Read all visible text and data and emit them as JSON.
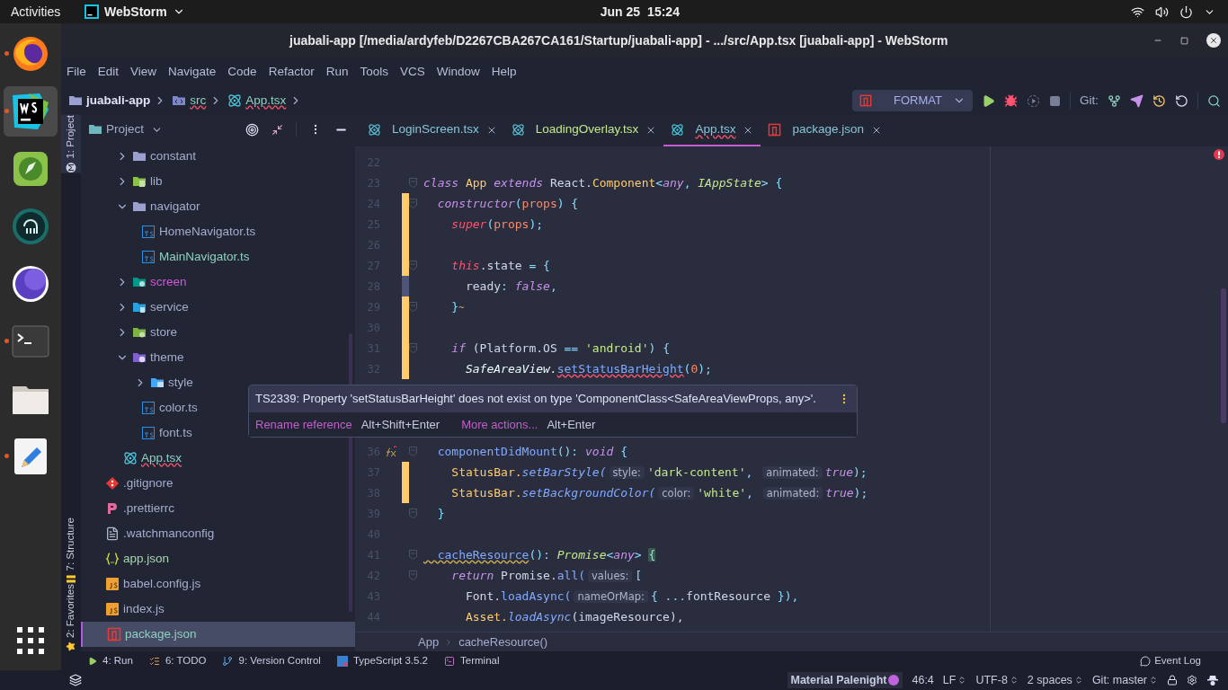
{
  "top_bar": {
    "activities": "Activities",
    "app_menu": "WebStorm",
    "date": "Jun 25",
    "time": "15:24"
  },
  "dock": [
    {
      "kind": "firefox",
      "running": true,
      "selected": false
    },
    {
      "kind": "webstorm",
      "running": true,
      "selected": true
    },
    {
      "kind": "rocket",
      "running": false,
      "selected": false
    },
    {
      "kind": "octopus",
      "running": false,
      "selected": false
    },
    {
      "kind": "moon",
      "running": false,
      "selected": false
    },
    {
      "kind": "terminal",
      "running": true,
      "selected": false
    },
    {
      "kind": "files",
      "running": false,
      "selected": false
    },
    {
      "kind": "editor",
      "running": true,
      "selected": false
    }
  ],
  "window": {
    "title": "juabali-app [/media/ardyfeb/D2267CBA267CA161/Startup/juabali-app] - .../src/App.tsx [juabali-app] - WebStorm"
  },
  "menu": [
    "File",
    "Edit",
    "View",
    "Navigate",
    "Code",
    "Refactor",
    "Run",
    "Tools",
    "VCS",
    "Window",
    "Help"
  ],
  "nav_path": [
    {
      "label": "juabali-app",
      "kind": "project",
      "error": false
    },
    {
      "label": "src",
      "kind": "source",
      "error": true
    },
    {
      "label": "App.tsx",
      "kind": "react",
      "error": true
    }
  ],
  "toolbar": {
    "run_config": "FORMAT",
    "git_label": "Git:"
  },
  "tool_strip": {
    "top": [
      {
        "label": "1: Project",
        "selected": true
      }
    ],
    "bottom": [
      {
        "label": "7: Structure",
        "selected": false
      },
      {
        "label": "2: Favorites",
        "selected": false
      }
    ]
  },
  "project": {
    "title": "Project",
    "src_children": [
      {
        "label": "constant",
        "kind": "folder",
        "expanded": false,
        "color": "#a6accd",
        "selected": false
      },
      {
        "label": "lib",
        "kind": "lib",
        "expanded": false,
        "color": "#a6accd",
        "selected": false
      },
      {
        "label": "navigator",
        "kind": "folder",
        "expanded": true,
        "color": "#a6accd",
        "selected": false,
        "children": [
          {
            "label": "HomeNavigator.ts",
            "kind": "ts",
            "color": "#a6accd",
            "selected": false
          },
          {
            "label": "MainNavigator.ts",
            "kind": "ts",
            "color": "#8ed1c0",
            "selected": false
          }
        ]
      },
      {
        "label": "screen",
        "kind": "screen",
        "expanded": false,
        "color": "#d05ad6",
        "selected": false
      },
      {
        "label": "service",
        "kind": "service",
        "expanded": false,
        "color": "#a6accd",
        "selected": false
      },
      {
        "label": "store",
        "kind": "store",
        "expanded": false,
        "color": "#a6accd",
        "selected": false
      },
      {
        "label": "theme",
        "kind": "theme",
        "expanded": true,
        "color": "#a6accd",
        "selected": false,
        "children": [
          {
            "label": "style",
            "kind": "style",
            "expanded": false,
            "color": "#a6accd",
            "selected": false
          },
          {
            "label": "color.ts",
            "kind": "ts",
            "color": "#a6accd",
            "selected": false
          },
          {
            "label": "font.ts",
            "kind": "ts",
            "color": "#a6accd",
            "selected": false
          }
        ]
      },
      {
        "label": "App.tsx",
        "kind": "react",
        "color": "#8ed1c0",
        "selected": false,
        "error": true
      }
    ],
    "root_items": [
      {
        "label": ".gitignore",
        "kind": "git",
        "color": "#a6accd",
        "selected": false
      },
      {
        "label": ".prettierrc",
        "kind": "prettier",
        "color": "#a6accd",
        "selected": false
      },
      {
        "label": ".watchmanconfig",
        "kind": "file",
        "color": "#a6accd",
        "selected": false
      },
      {
        "label": "app.json",
        "kind": "json",
        "color": "#a8d4b0",
        "selected": false
      },
      {
        "label": "babel.config.js",
        "kind": "js",
        "color": "#a6accd",
        "selected": false
      },
      {
        "label": "index.js",
        "kind": "js",
        "color": "#a6accd",
        "selected": false
      },
      {
        "label": "package.json",
        "kind": "npm",
        "color": "#8ed1c0",
        "selected": true
      }
    ]
  },
  "tabs": [
    {
      "label": "LoginScreen.tsx",
      "kind": "react",
      "color": "#89c4d8",
      "selected": false,
      "error": false
    },
    {
      "label": "LoadingOverlay.tsx",
      "kind": "react",
      "color": "#c3e88d",
      "selected": false,
      "error": false
    },
    {
      "label": "App.tsx",
      "kind": "react",
      "color": "#89c4d8",
      "selected": true,
      "error": true
    },
    {
      "label": "package.json",
      "kind": "npm",
      "color": "#89c4d8",
      "selected": false,
      "error": false
    }
  ],
  "editor": {
    "lines_top": [
      {
        "number": "22",
        "kind": "plain",
        "fold": false
      },
      {
        "number": "23",
        "kind": "plain",
        "fold": true,
        "tokens": [
          {
            "text": "class ",
            "kind": "kw"
          },
          {
            "text": "App ",
            "kind": "cls"
          },
          {
            "text": "extends ",
            "kind": "kw"
          },
          {
            "text": "React.",
            "kind": "plain"
          },
          {
            "text": "Component",
            "kind": "cls"
          },
          {
            "text": "<",
            "kind": "punct"
          },
          {
            "text": "any",
            "kind": "kw"
          },
          {
            "text": ", ",
            "kind": "punct"
          },
          {
            "text": "IAppState",
            "kind": "type"
          },
          {
            "text": "> {",
            "kind": "punct"
          }
        ]
      },
      {
        "number": "24",
        "kind": "added",
        "fold": true,
        "tokens": [
          {
            "text": "  constructor",
            "kind": "kw"
          },
          {
            "text": "(",
            "kind": "punct"
          },
          {
            "text": "props",
            "kind": "param"
          },
          {
            "text": ") {",
            "kind": "punct"
          }
        ]
      },
      {
        "number": "25",
        "kind": "added",
        "fold": false,
        "tokens": [
          {
            "text": "    super",
            "kind": "self"
          },
          {
            "text": "(",
            "kind": "punct"
          },
          {
            "text": "props",
            "kind": "param"
          },
          {
            "text": ");",
            "kind": "punct"
          }
        ]
      },
      {
        "number": "26",
        "kind": "added",
        "fold": false
      },
      {
        "number": "27",
        "kind": "added",
        "fold": true,
        "tokens": [
          {
            "text": "    this",
            "kind": "self"
          },
          {
            "text": ".state",
            "kind": "plain"
          },
          {
            "text": " = {",
            "kind": "punct"
          }
        ]
      },
      {
        "number": "28",
        "kind": "modified",
        "fold": false,
        "tokens": [
          {
            "text": "      ready",
            "kind": "plain"
          },
          {
            "text": ": ",
            "kind": "punct"
          },
          {
            "text": "false",
            "kind": "kw"
          },
          {
            "text": ",",
            "kind": "punct"
          }
        ]
      },
      {
        "number": "29",
        "kind": "added",
        "fold": true,
        "tokens": [
          {
            "text": "    }",
            "kind": "punct"
          },
          {
            "text": "~",
            "kind": "warnmark"
          }
        ]
      },
      {
        "number": "30",
        "kind": "added",
        "fold": false
      },
      {
        "number": "31",
        "kind": "added",
        "fold": true,
        "tokens": [
          {
            "text": "    if",
            "kind": "kw"
          },
          {
            "text": " (Platform.OS",
            "kind": "plain"
          },
          {
            "text": " == ",
            "kind": "punct"
          },
          {
            "text": "'android'",
            "kind": "str"
          },
          {
            "text": ") {",
            "kind": "punct"
          }
        ]
      },
      {
        "number": "32",
        "kind": "added",
        "fold": false,
        "tokens": [
          {
            "text": "      SafeAreaView.",
            "kind": "itl"
          },
          {
            "text": "setStatusBarHeight",
            "kind": "err"
          },
          {
            "text": "(",
            "kind": "punct"
          },
          {
            "text": "0",
            "kind": "num"
          },
          {
            "text": ");",
            "kind": "punct"
          }
        ]
      }
    ],
    "lines_bottom": [
      {
        "number": "36",
        "kind": "plain",
        "fold": true,
        "override": true,
        "tokens": [
          {
            "text": "  componentDidMount",
            "kind": "fn"
          },
          {
            "text": "(): ",
            "kind": "punct"
          },
          {
            "text": "void",
            "kind": "kw"
          },
          {
            "text": " {",
            "kind": "punct"
          }
        ]
      },
      {
        "number": "37",
        "kind": "added",
        "fold": false,
        "tokens": [
          {
            "text": "    StatusBar.",
            "kind": "cls"
          },
          {
            "text": "setBarStyle(",
            "kind": "fni"
          },
          {
            "text": "style:",
            "kind": "hint"
          },
          {
            "text": "'dark-content'",
            "kind": "str"
          },
          {
            "text": ", ",
            "kind": "punct"
          },
          {
            "text": "animated:",
            "kind": "hint"
          },
          {
            "text": "true",
            "kind": "kw"
          },
          {
            "text": ");",
            "kind": "punct"
          }
        ]
      },
      {
        "number": "38",
        "kind": "added",
        "fold": false,
        "tokens": [
          {
            "text": "    StatusBar.",
            "kind": "cls"
          },
          {
            "text": "setBackgroundColor(",
            "kind": "fni"
          },
          {
            "text": "color:",
            "kind": "hint"
          },
          {
            "text": "'white'",
            "kind": "str"
          },
          {
            "text": ", ",
            "kind": "punct"
          },
          {
            "text": "animated:",
            "kind": "hint"
          },
          {
            "text": "true",
            "kind": "kw"
          },
          {
            "text": ");",
            "kind": "punct"
          }
        ]
      },
      {
        "number": "39",
        "kind": "plain",
        "fold": true,
        "tokens": [
          {
            "text": "  }",
            "kind": "punct"
          }
        ]
      },
      {
        "number": "40",
        "kind": "plain",
        "fold": false
      },
      {
        "number": "41",
        "kind": "plain",
        "fold": true,
        "tokens": [
          {
            "text": "  cacheResource",
            "kind": "warn"
          },
          {
            "text": "(): ",
            "kind": "punct"
          },
          {
            "text": "Promise",
            "kind": "type"
          },
          {
            "text": "<",
            "kind": "punct"
          },
          {
            "text": "any",
            "kind": "kw"
          },
          {
            "text": "> ",
            "kind": "punct"
          },
          {
            "text": "{",
            "kind": "brace"
          }
        ]
      },
      {
        "number": "42",
        "kind": "plain",
        "fold": true,
        "tokens": [
          {
            "text": "    return",
            "kind": "kw"
          },
          {
            "text": " Promise.",
            "kind": "plain"
          },
          {
            "text": "all(",
            "kind": "fn"
          },
          {
            "text": "values:",
            "kind": "hint"
          },
          {
            "text": "[",
            "kind": "punct"
          }
        ]
      },
      {
        "number": "43",
        "kind": "plain",
        "fold": false,
        "tokens": [
          {
            "text": "      Font.",
            "kind": "plain"
          },
          {
            "text": "loadAsync(",
            "kind": "fn"
          },
          {
            "text": "nameOrMap:",
            "kind": "hint"
          },
          {
            "text": "{ ...",
            "kind": "punct"
          },
          {
            "text": "fontResource",
            "kind": "plain"
          },
          {
            "text": " }),",
            "kind": "punct"
          }
        ]
      },
      {
        "number": "44",
        "kind": "plain",
        "fold": false,
        "tokens": [
          {
            "text": "      Asset.",
            "kind": "cls"
          },
          {
            "text": "loadAsync",
            "kind": "fni"
          },
          {
            "text": "(imageResource),",
            "kind": "plain"
          }
        ]
      }
    ],
    "breadcrumbs": [
      "App",
      "cacheResource()"
    ]
  },
  "tooltip": {
    "message": "TS2339: Property 'setStatusBarHeight' does not exist on type 'ComponentClass<SafeAreaViewProps, any>'.",
    "actions": [
      {
        "label": "Rename reference",
        "shortcut": "Alt+Shift+Enter"
      },
      {
        "label": "More actions...",
        "shortcut": "Alt+Enter"
      }
    ]
  },
  "tool_windows": [
    {
      "label": "4: Run",
      "kind": "run"
    },
    {
      "label": "6: TODO",
      "kind": "todo"
    },
    {
      "label": "9: Version Control",
      "kind": "vcs"
    },
    {
      "label": "TypeScript 3.5.2",
      "kind": "ts"
    },
    {
      "label": "Terminal",
      "kind": "terminal"
    }
  ],
  "event_log": "Event Log",
  "status_bar": {
    "theme": "Material Palenight",
    "color": "#c062e0",
    "position": "46:4",
    "line_ending": "LF",
    "encoding": "UTF-8",
    "indent": "2 spaces",
    "branch": "Git: master"
  }
}
